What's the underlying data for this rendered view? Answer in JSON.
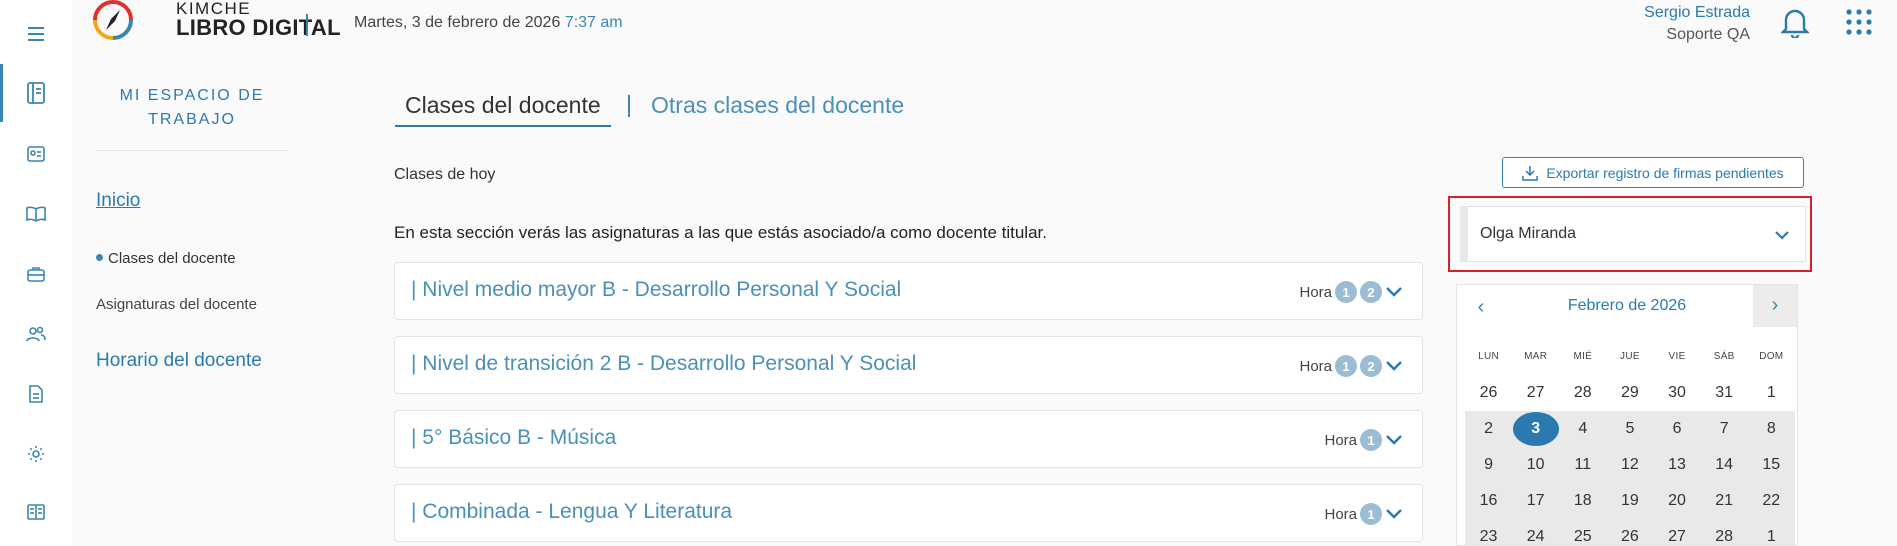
{
  "app": {
    "brand_line1": "KIMCHE",
    "brand_line2": "LIBRO DIGITAL",
    "date": "Martes, 3 de febrero de 2026",
    "time": "7:37 am"
  },
  "user": {
    "name": "Sergio Estrada",
    "role": "Soporte QA"
  },
  "rail_icons": [
    "menu-icon",
    "book-icon",
    "id-card-icon",
    "open-book-icon",
    "briefcase-icon",
    "users-icon",
    "document-icon",
    "gear-icon",
    "reader-icon"
  ],
  "sidebar": {
    "title": "MI ESPACIO DE TRABAJO",
    "inicio": "Inicio",
    "clases": "Clases del docente",
    "asignaturas": "Asignaturas del docente",
    "horario": "Horario del docente"
  },
  "tabs": {
    "active": "Clases del docente",
    "other": "Otras clases del docente"
  },
  "main": {
    "today_label": "Clases de hoy",
    "description": "En esta sección verás las asignaturas a las que estás asociado/a como docente titular.",
    "export_label": "Exportar registro de firmas pendientes",
    "hora_label": "Hora",
    "classes": [
      {
        "title": "| Nivel medio mayor B - Desarrollo Personal Y Social",
        "hours": [
          "1",
          "2"
        ]
      },
      {
        "title": "| Nivel de transición 2 B - Desarrollo Personal Y Social",
        "hours": [
          "1",
          "2"
        ]
      },
      {
        "title": "| 5° Básico B - Música",
        "hours": [
          "1"
        ]
      },
      {
        "title": "| Combinada - Lengua Y Literatura",
        "hours": [
          "1"
        ]
      }
    ]
  },
  "teacher_select": {
    "value": "Olga Miranda"
  },
  "calendar": {
    "month": "Febrero de 2026",
    "prev": "‹",
    "next": "›",
    "weekdays": [
      "LUN",
      "MAR",
      "MIÉ",
      "JUE",
      "VIE",
      "SÁB",
      "DOM"
    ],
    "days": [
      "26",
      "27",
      "28",
      "29",
      "30",
      "31",
      "1",
      "2",
      "3",
      "4",
      "5",
      "6",
      "7",
      "8",
      "9",
      "10",
      "11",
      "12",
      "13",
      "14",
      "15",
      "16",
      "17",
      "18",
      "19",
      "20",
      "21",
      "22",
      "23",
      "24",
      "25",
      "26",
      "27",
      "28",
      "1"
    ],
    "selected": "3"
  },
  "colors": {
    "accent": "#2a7ab0",
    "highlight_border": "#d4202a",
    "badge": "#9bbdd4"
  }
}
